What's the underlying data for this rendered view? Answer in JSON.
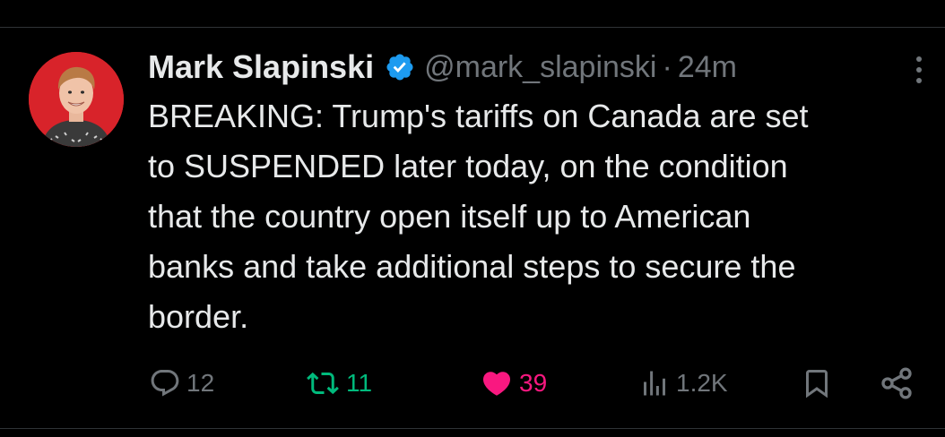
{
  "tweet": {
    "display_name": "Mark Slapinski",
    "handle": "@mark_slapinski",
    "separator": "·",
    "time": "24m",
    "text": "BREAKING: Trump's tariffs on Canada are set\nto SUSPENDED later today, on the condition\nthat the country open itself up to American\nbanks and take additional steps to secure the\nborder.",
    "verified": true
  },
  "actions": {
    "replies": "12",
    "retweets": "11",
    "likes": "39",
    "views": "1.2K"
  },
  "icons": {
    "reply": "reply-icon",
    "retweet": "retweet-icon",
    "like": "heart-icon",
    "views": "views-icon",
    "bookmark": "bookmark-icon",
    "share": "share-icon",
    "more": "more-icon",
    "verified": "verified-badge-icon"
  },
  "colors": {
    "background": "#000000",
    "text": "#e7e9ea",
    "secondary": "#71767b",
    "verified": "#1d9bf0",
    "retweet_active": "#00ba7c",
    "like_active": "#f91880",
    "avatar_bg": "#d8232a"
  }
}
